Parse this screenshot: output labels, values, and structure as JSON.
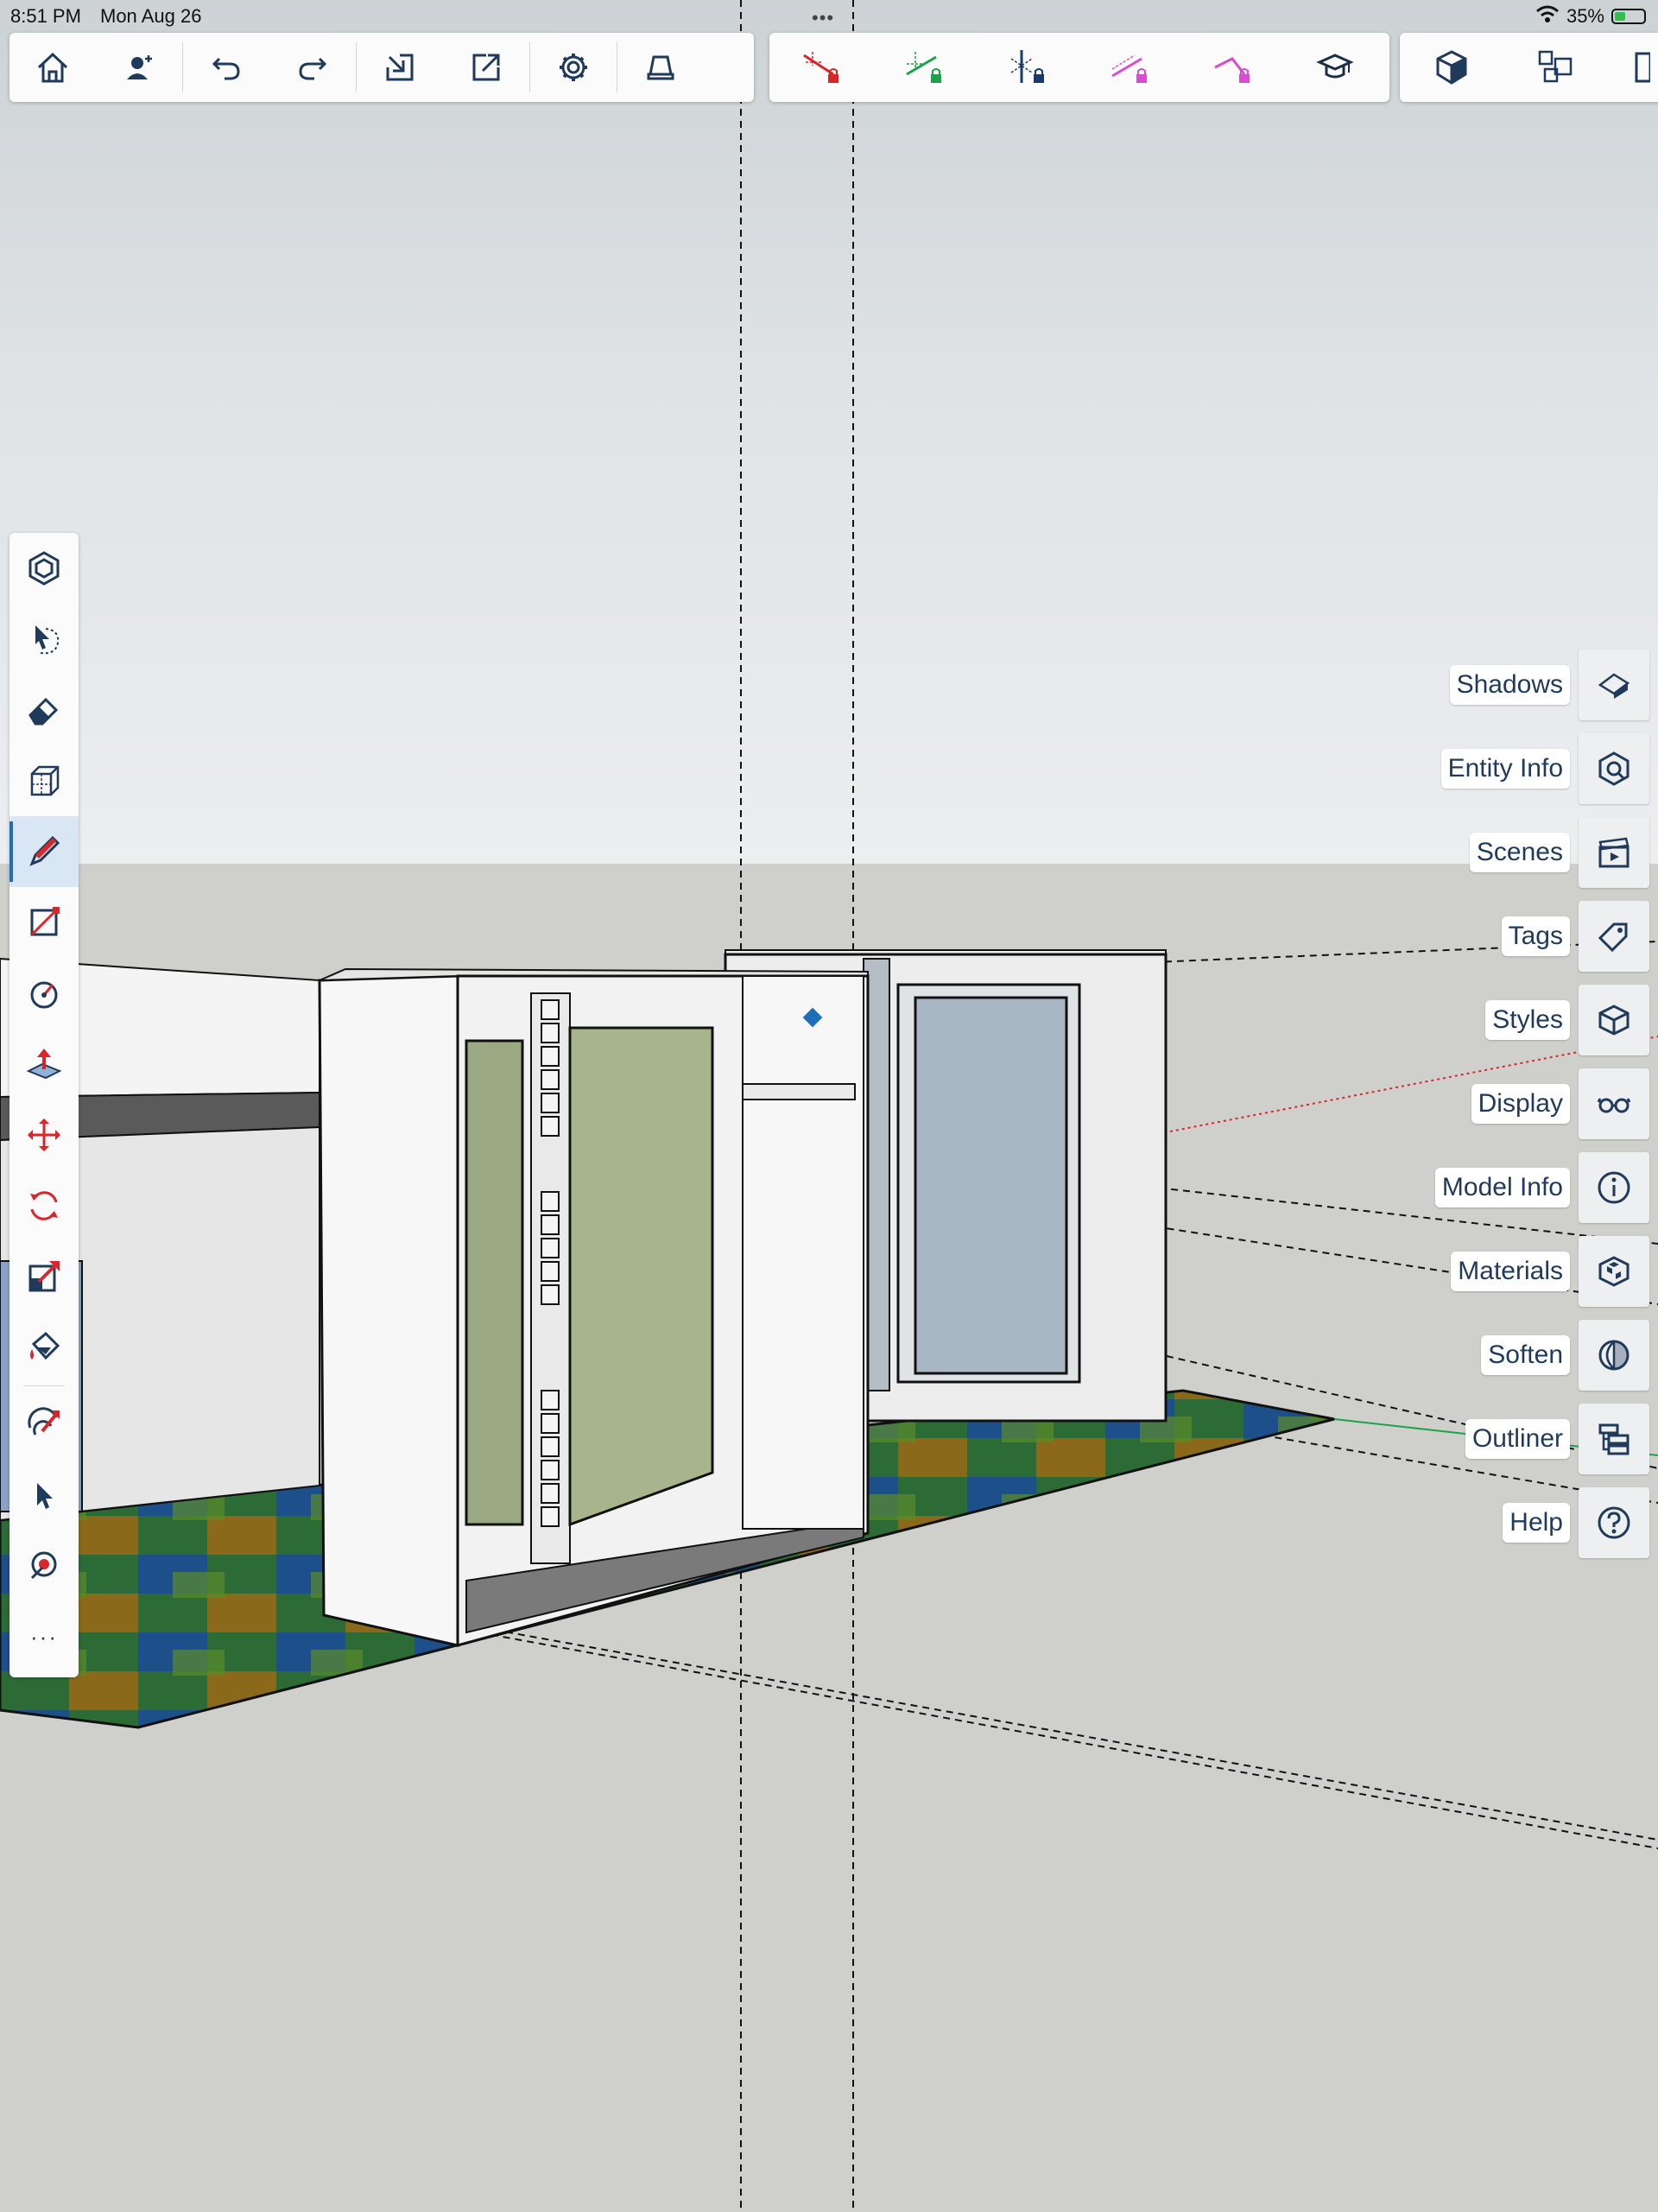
{
  "status_bar": {
    "time": "8:51 PM",
    "date": "Mon Aug 26",
    "multitask_dots": "•••",
    "battery_percent": "35%"
  },
  "toolbar_main": [
    {
      "icon": "home-icon"
    },
    {
      "icon": "add-user-icon"
    },
    {
      "icon": "undo-icon"
    },
    {
      "icon": "redo-icon"
    },
    {
      "icon": "import-icon"
    },
    {
      "icon": "export-icon"
    },
    {
      "icon": "gear-icon"
    },
    {
      "icon": "eraser-view-icon"
    }
  ],
  "toolbar_inference": [
    {
      "icon": "lock-red-axis-icon",
      "color": "#d8262b"
    },
    {
      "icon": "lock-green-axis-icon",
      "color": "#1aa34a"
    },
    {
      "icon": "lock-blue-axis-icon",
      "color": "#1a3a6a"
    },
    {
      "icon": "lock-magenta-icon",
      "color": "#d94bd1"
    },
    {
      "icon": "lock-magenta-2-icon",
      "color": "#d94bd1"
    },
    {
      "icon": "learn-icon",
      "color": "#1a2e4a"
    }
  ],
  "toolbar_views": [
    {
      "icon": "view-iso-icon"
    },
    {
      "icon": "components-icon"
    },
    {
      "icon": "views-more-icon"
    }
  ],
  "tools": [
    {
      "icon": "components-tool-icon"
    },
    {
      "icon": "select-lasso-icon"
    },
    {
      "icon": "eraser-icon"
    },
    {
      "icon": "box-icon"
    },
    {
      "icon": "pencil-icon",
      "active": true
    },
    {
      "icon": "rectangle-icon"
    },
    {
      "icon": "circle-icon"
    },
    {
      "icon": "push-pull-icon"
    },
    {
      "icon": "move-icon"
    },
    {
      "icon": "rotate-icon"
    },
    {
      "icon": "scale-icon"
    },
    {
      "icon": "paint-bucket-icon"
    },
    {
      "icon": "orbit-icon"
    },
    {
      "icon": "select-arrow-icon"
    },
    {
      "icon": "tape-measure-icon"
    }
  ],
  "tools_more_label": "···",
  "panels": [
    {
      "label": "Shadows",
      "icon": "shadows-icon"
    },
    {
      "label": "Entity Info",
      "icon": "entity-info-icon"
    },
    {
      "label": "Scenes",
      "icon": "scenes-icon"
    },
    {
      "label": "Tags",
      "icon": "tags-icon"
    },
    {
      "label": "Styles",
      "icon": "styles-icon"
    },
    {
      "label": "Display",
      "icon": "display-icon"
    },
    {
      "label": "Model Info",
      "icon": "model-info-icon"
    },
    {
      "label": "Materials",
      "icon": "materials-icon"
    },
    {
      "label": "Soften",
      "icon": "soften-icon"
    },
    {
      "label": "Outliner",
      "icon": "outliner-icon"
    },
    {
      "label": "Help",
      "icon": "help-icon"
    }
  ],
  "colors": {
    "icon": "#1f3a5a",
    "active_tool_bg": "#d9e6f3",
    "accent": "#1e6fb8",
    "red_tool": "#d8262b"
  }
}
